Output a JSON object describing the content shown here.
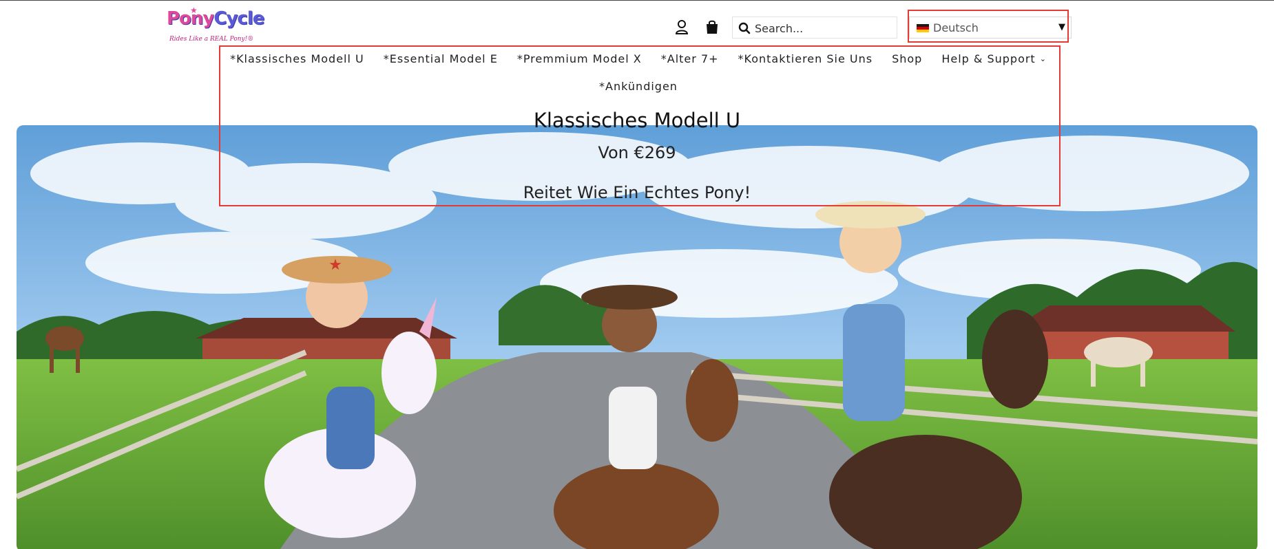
{
  "brand": {
    "logo_text_pony": "Pony",
    "logo_text_cycle": "Cycle",
    "tagline": "Rides Like a REAL Pony!®"
  },
  "header": {
    "search": {
      "placeholder": "Search..."
    },
    "language": {
      "selected": "Deutsch",
      "flag": "german-flag-icon"
    },
    "icons": [
      "user-icon",
      "shopping-bag-icon",
      "search-icon",
      "caret-down-icon"
    ]
  },
  "nav": {
    "items": [
      {
        "label": "*Klassisches Modell U"
      },
      {
        "label": "*Essential Model E"
      },
      {
        "label": "*Premmium Model X"
      },
      {
        "label": "*Alter 7+"
      },
      {
        "label": "*Kontaktieren Sie Uns"
      },
      {
        "label": "Shop"
      },
      {
        "label": "Help & Support"
      },
      {
        "label": "*Ankündigen"
      }
    ]
  },
  "hero": {
    "title": "Klassisches Modell U",
    "price": "Von €269",
    "tagline": "Reitet Wie Ein Echtes Pony!"
  },
  "colors": {
    "highlight": "#e53935",
    "brand_pink": "#e0489a",
    "brand_blue": "#5a5ad6",
    "sky": "#7fb6e6",
    "grass": "#6cae3a"
  }
}
